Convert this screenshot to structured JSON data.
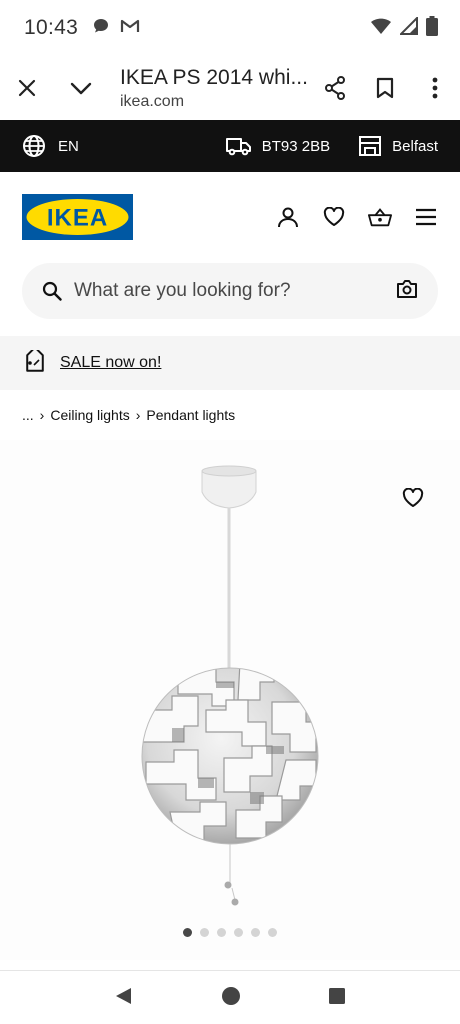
{
  "status_bar": {
    "time": "10:43"
  },
  "browser": {
    "title": "IKEA PS 2014 whi...",
    "url": "ikea.com"
  },
  "location_bar": {
    "language": "EN",
    "postcode": "BT93 2BB",
    "store": "Belfast"
  },
  "header": {
    "logo_text": "IKEA"
  },
  "search": {
    "placeholder": "What are you looking for?"
  },
  "sale_banner": {
    "label": "SALE now on!"
  },
  "breadcrumb": {
    "ellipsis": "...",
    "items": [
      "Ceiling lights",
      "Pendant lights"
    ]
  },
  "gallery": {
    "image_count": 6,
    "active_index": 0
  },
  "colors": {
    "ikea_blue": "#0058a3",
    "ikea_yellow": "#ffdb00",
    "topbar": "#111111"
  }
}
